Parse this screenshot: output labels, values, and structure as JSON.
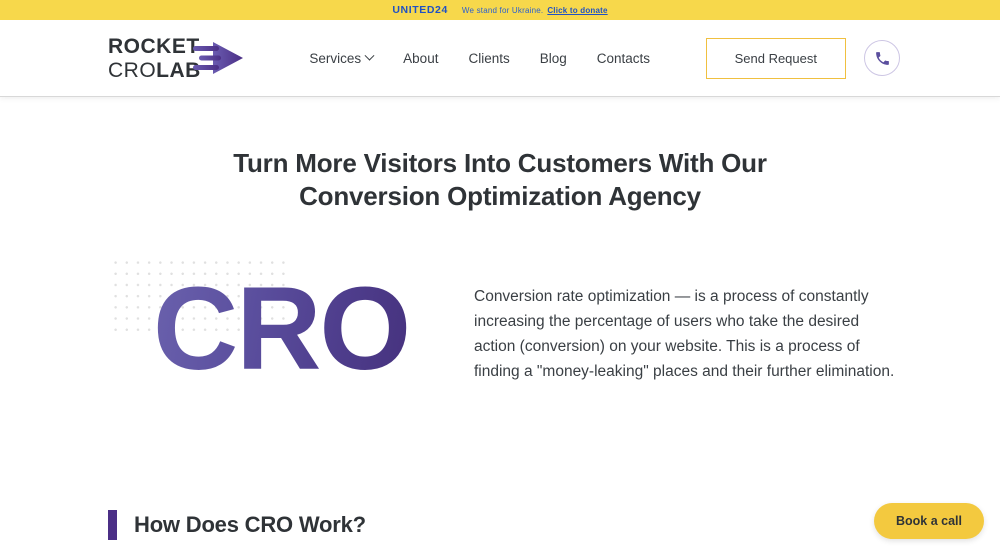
{
  "banner": {
    "logo_text": "UNITED24",
    "message": "We stand for Ukraine.",
    "donate_link": "Click to donate",
    "background_color": "#f7d84b",
    "text_color": "#1f51c4"
  },
  "header": {
    "logo": {
      "line1": "ROCKET",
      "line2_thin": "CRO",
      "line2_bold": "LAB",
      "arrow_icon": "rocket-arrow-icon",
      "arrow_color": "#5b3fa0"
    },
    "nav": [
      {
        "label": "Services",
        "has_dropdown": true
      },
      {
        "label": "About",
        "has_dropdown": false
      },
      {
        "label": "Clients",
        "has_dropdown": false
      },
      {
        "label": "Blog",
        "has_dropdown": false
      },
      {
        "label": "Contacts",
        "has_dropdown": false
      }
    ],
    "send_request_label": "Send Request",
    "send_request_border_color": "#f0c040",
    "phone_icon": "phone-icon",
    "phone_icon_color": "#5b4f9e"
  },
  "hero": {
    "title_line1": "Turn More Visitors Into Customers With Our",
    "title_line2": "Conversion Optimization Agency",
    "art_text": "CRO",
    "art_gradient_from": "#6a61ad",
    "art_gradient_to": "#46327e",
    "paragraph": "Conversion rate optimization — is a process of constantly increasing the percentage of users who take the desired action (conversion) on your website. This is a process of finding a \"money-leaking\" places and their further elimination."
  },
  "section": {
    "accent_color": "#4b2f86",
    "title": "How Does CRO Work?"
  },
  "floating_cta": {
    "label": "Book a call",
    "background_color": "#f3c93f"
  }
}
